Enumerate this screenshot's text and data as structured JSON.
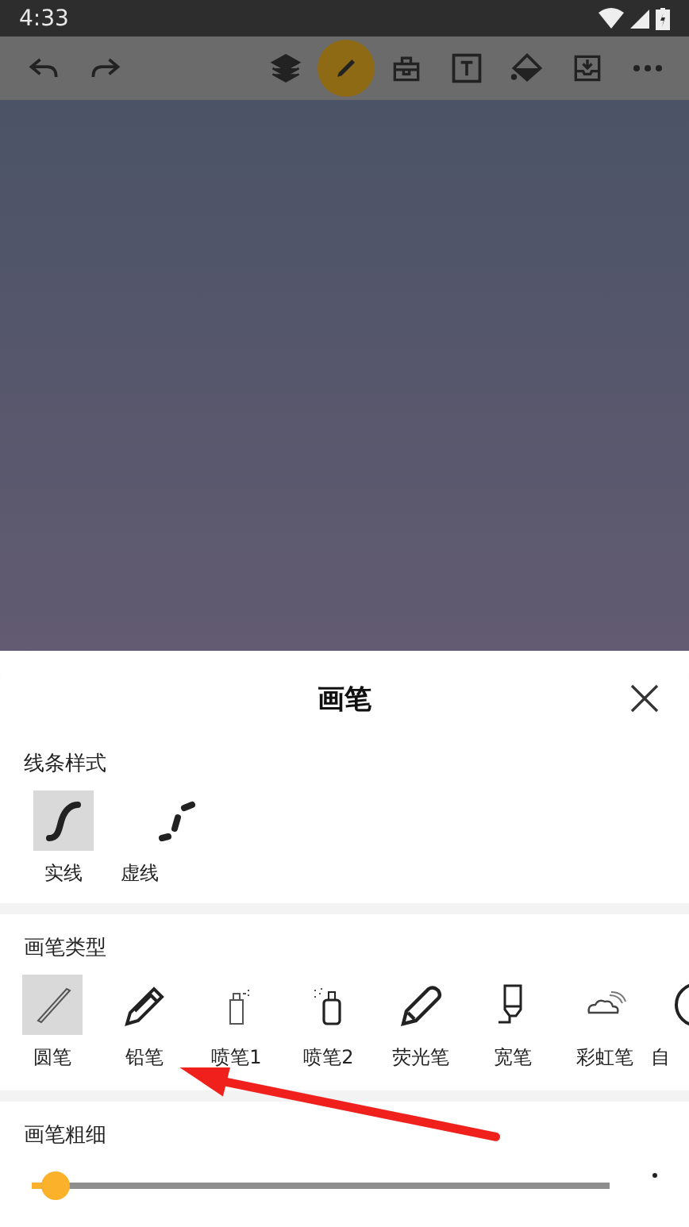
{
  "status_bar": {
    "time": "4:33"
  },
  "toolbar": {
    "tools": [
      {
        "selected": false
      },
      {
        "selected": false
      },
      {
        "selected": false
      },
      {
        "selected": true
      },
      {
        "selected": false
      },
      {
        "selected": false
      },
      {
        "selected": false
      },
      {
        "selected": false
      },
      {
        "selected": false
      }
    ]
  },
  "sheet": {
    "title": "画笔",
    "line_style": {
      "label": "线条样式",
      "items": [
        {
          "label": "实线",
          "selected": true
        },
        {
          "label": "虚线",
          "selected": false
        }
      ]
    },
    "brush_type": {
      "label": "画笔类型",
      "items": [
        {
          "label": "圆笔",
          "selected": true
        },
        {
          "label": "铅笔",
          "selected": false
        },
        {
          "label": "喷笔1",
          "selected": false
        },
        {
          "label": "喷笔2",
          "selected": false
        },
        {
          "label": "荧光笔",
          "selected": false
        },
        {
          "label": "宽笔",
          "selected": false
        },
        {
          "label": "彩虹笔",
          "selected": false
        },
        {
          "label": "自",
          "selected": false
        }
      ]
    },
    "thickness": {
      "label": "画笔粗细",
      "level": 0.04
    }
  }
}
